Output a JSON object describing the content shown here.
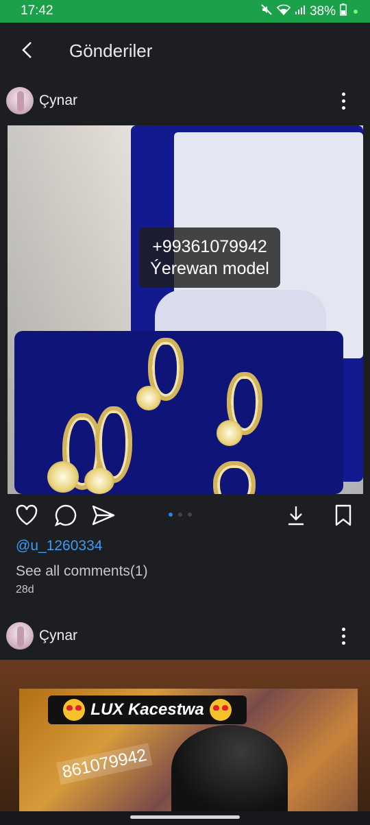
{
  "status_bar": {
    "time": "17:42",
    "battery": "38%",
    "icons": [
      "mute-icon",
      "wifi-icon",
      "signal-icon",
      "battery-icon"
    ]
  },
  "app_bar": {
    "title": "Gönderiler",
    "back_icon": "chevron-left-icon"
  },
  "posts": [
    {
      "username": "Çynar",
      "overlay_line1": "+99361079942",
      "overlay_line2": "Ýerewan model",
      "carousel": {
        "count": 3,
        "active": 1
      },
      "mention": "@u_1260334",
      "comments_link": "See all comments(1)",
      "age": "28d"
    },
    {
      "username": "Çynar",
      "banner_text": "LUX Kacestwa",
      "watermark_phone": "861079942"
    }
  ],
  "colors": {
    "status_bar_bg": "#1aa14a",
    "background": "#1d1e22",
    "link_blue": "#3d9cf2",
    "active_dot": "#1e88e5"
  }
}
